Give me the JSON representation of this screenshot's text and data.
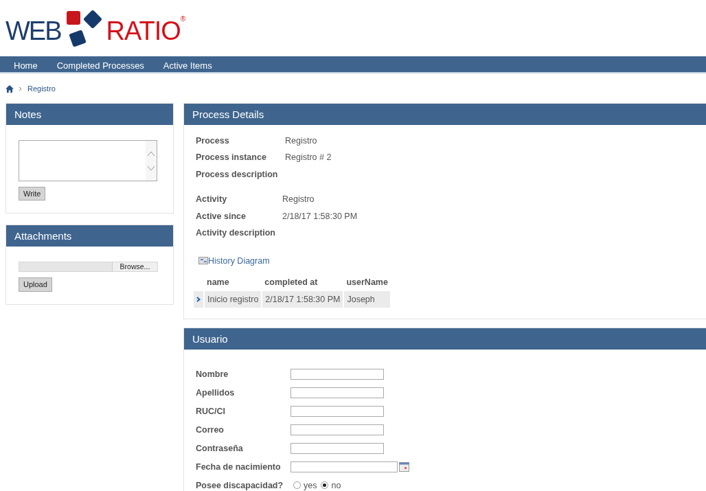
{
  "logo": {
    "left": "WEB",
    "right": "RATIO",
    "mark": "®"
  },
  "nav": [
    {
      "label": "Home"
    },
    {
      "label": "Completed Processes"
    },
    {
      "label": "Active Items"
    }
  ],
  "breadcrumb": [
    "Registro"
  ],
  "notes": {
    "title": "Notes",
    "button": "Write"
  },
  "attachments": {
    "title": "Attachments",
    "browse": "Browse...",
    "button": "Upload"
  },
  "process_details": {
    "title": "Process Details",
    "groups": [
      [
        {
          "label": "Process",
          "value": "Registro"
        },
        {
          "label": "Process instance",
          "value": "Registro # 2"
        },
        {
          "label": "Process description"
        }
      ],
      [
        {
          "label": "Activity",
          "value": "Registro"
        },
        {
          "label": "Active since",
          "value": "2/18/17 1:58:30 PM"
        },
        {
          "label": "Activity description"
        }
      ]
    ],
    "link": "History Diagram",
    "table": {
      "columns": [
        "name",
        "completed at",
        "userName"
      ],
      "rows": [
        [
          "Inicio registro",
          "2/18/17 1:58:30 PM",
          "Joseph"
        ]
      ]
    }
  },
  "usuario": {
    "title": "Usuario",
    "fields": [
      {
        "kind": "text",
        "label": "Nombre"
      },
      {
        "kind": "text",
        "label": "Apellidos"
      },
      {
        "kind": "text",
        "label": "RUC/CI"
      },
      {
        "kind": "text",
        "label": "Correo"
      },
      {
        "kind": "text",
        "label": "Contraseña"
      },
      {
        "kind": "date",
        "label": "Fecha de nacimiento"
      },
      {
        "kind": "radio",
        "label": "Posee discapacidad?",
        "options": [
          {
            "label": "yes",
            "selected": false
          },
          {
            "label": "no",
            "selected": true
          }
        ]
      }
    ]
  }
}
